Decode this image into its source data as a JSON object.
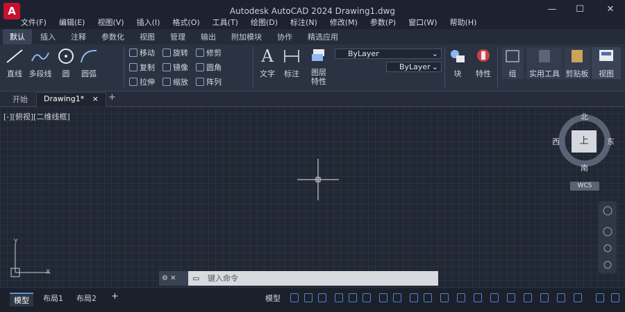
{
  "app": {
    "logo_letter": "A",
    "title": "Autodesk AutoCAD 2024  Drawing1.dwg"
  },
  "window": {
    "minimize": "—",
    "maximize": "☐",
    "close": "✕"
  },
  "menu": [
    "文件(F)",
    "编辑(E)",
    "视图(V)",
    "插入(I)",
    "格式(O)",
    "工具(T)",
    "绘图(D)",
    "标注(N)",
    "修改(M)",
    "参数(P)",
    "窗口(W)",
    "帮助(H)"
  ],
  "ribbon_tabs": [
    "默认",
    "插入",
    "注释",
    "参数化",
    "视图",
    "管理",
    "输出",
    "附加模块",
    "协作",
    "精选应用"
  ],
  "ribbon": {
    "draw": {
      "line": "直线",
      "polyline": "多段线",
      "circle": "圆",
      "arc": "圆弧"
    },
    "modify": {
      "move": "移动",
      "rotate": "旋转",
      "trim": "修剪",
      "copy": "复制",
      "mirror": "镜像",
      "fillet": "圆角",
      "stretch": "拉伸",
      "scale": "缩放",
      "array": "阵列"
    },
    "annotation": {
      "text": "文字",
      "dimension": "标注"
    },
    "layers": {
      "properties": "图层特性",
      "layer_name": "ByLayer",
      "layer_name2": "ByLayer"
    },
    "block": "块",
    "properties": "特性",
    "group": "组",
    "utilities": "实用工具",
    "clipboard": "剪贴板",
    "view": "视图"
  },
  "file_tabs": {
    "start": "开始",
    "drawing": "Drawing1*",
    "close": "×",
    "add": "+"
  },
  "viewport_label": "[-][俯视][二维线框]",
  "viewcube": {
    "north": "北",
    "south": "南",
    "east": "东",
    "west": "西",
    "top": "上",
    "wcs": "WCS"
  },
  "ucs": {
    "y": "Y",
    "x": "X"
  },
  "command": {
    "placeholder": "键入命令"
  },
  "status": {
    "model": "模型",
    "layout1": "布局1",
    "layout2": "布局2",
    "add": "+",
    "model_btn": "模型"
  }
}
